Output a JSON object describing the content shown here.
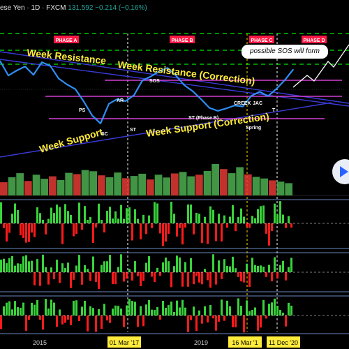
{
  "header": {
    "symbol_text": "ese Yen · 1D · FXCM",
    "price": "131.592",
    "change": "−0.214 (−0.16%)"
  },
  "phases": [
    "PHASE A",
    "PHASE B",
    "PHASE C",
    "PHASE D"
  ],
  "callout": "possible SOS will form",
  "annotations": {
    "week_resistance": "Week Resistance",
    "week_resistance_correction": "Week Resistance (Correction)",
    "week_support": "Week Support",
    "week_support_correction": "Week Support (Correction)",
    "ps": "PS",
    "sc": "SC",
    "ar": "AR",
    "st": "ST",
    "sos": "SOS",
    "st_phase_b": "ST (Phase B)",
    "creek": "CREEK",
    "jac": "JAC",
    "spring": "Spring",
    "t": "T"
  },
  "colors": {
    "background": "#000000",
    "price_line": "#2f8ef5",
    "resistance_line": "#3a3ad8",
    "magenta_line": "#d43fd4",
    "phase_dash": "#00e600",
    "phase_label_bg": "#ff1744",
    "annotation_text": "#ffeb3b",
    "volume_up": "#4caf50",
    "volume_down": "#e53935",
    "indicator_green": "#39d33b",
    "indicator_red": "#ff1a1a"
  },
  "chart_data": {
    "type": "line",
    "x_tick_labels": [
      "2015",
      "01 Mar '17",
      "2019",
      "16 Mar '1",
      "11 Dec '20"
    ],
    "series": [
      {
        "values": [
          124.5,
          120.1,
          121.6,
          122.8,
          120.3,
          124.1,
          123.0,
          119.2,
          117.4,
          116.0,
          112.3,
          108.1,
          105.7,
          111.6,
          113.0,
          112.4,
          114.2,
          118.6,
          119.8,
          121.3,
          122.4,
          120.1,
          117.2,
          115.4,
          113.0,
          110.4,
          109.5,
          110.2,
          111.1,
          110.8,
          114.0,
          115.2,
          113.9,
          116.1,
          118.7,
          121.9
        ]
      }
    ],
    "volume": [
      0.42,
      0.58,
      0.71,
      0.46,
      0.66,
      0.53,
      0.61,
      0.49,
      0.72,
      0.68,
      0.81,
      0.77,
      0.64,
      0.58,
      0.73,
      0.55,
      0.62,
      0.69,
      0.51,
      0.66,
      0.57,
      0.7,
      0.75,
      0.61,
      0.66,
      0.78,
      1.0,
      0.84,
      0.71,
      0.9,
      0.67,
      0.59,
      0.54,
      0.48,
      0.44,
      0.39
    ],
    "grid": false
  }
}
